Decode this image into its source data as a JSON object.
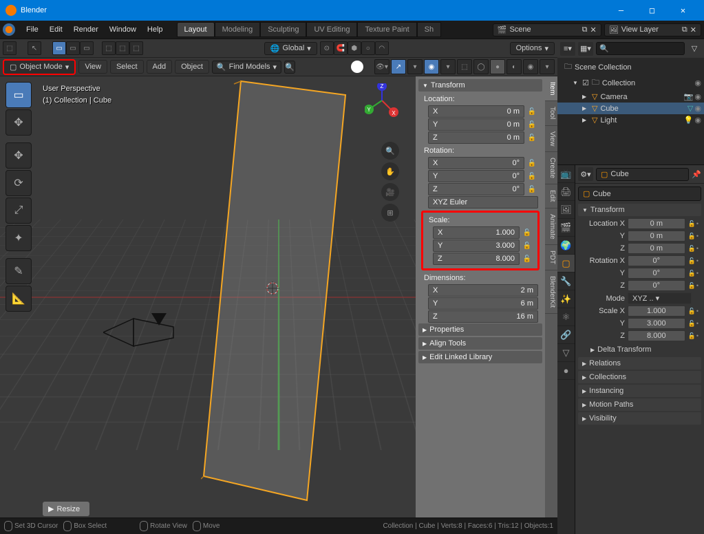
{
  "window": {
    "title": "Blender"
  },
  "window_controls": {
    "min": "—",
    "max": "□",
    "close": "✕"
  },
  "menu": {
    "file": "File",
    "edit": "Edit",
    "render": "Render",
    "window": "Window",
    "help": "Help"
  },
  "workspace_tabs": [
    "Layout",
    "Modeling",
    "Sculpting",
    "UV Editing",
    "Texture Paint",
    "Sh"
  ],
  "scene_field": {
    "label": "Scene",
    "icon": "🎬"
  },
  "viewlayer_field": {
    "label": "View Layer",
    "icon": "🖼"
  },
  "header": {
    "orientation": "Global",
    "options": "Options"
  },
  "toolbar2": {
    "mode": "Object Mode",
    "view": "View",
    "select": "Select",
    "add": "Add",
    "object": "Object",
    "find_models": "Find Models",
    "search_placeholder": ""
  },
  "viewport_info": {
    "line1": "User Perspective",
    "line2": "(1) Collection | Cube"
  },
  "n_panel": {
    "header": "Transform",
    "location_label": "Location:",
    "rotation_label": "Rotation:",
    "euler": "XYZ Euler",
    "scale_label": "Scale:",
    "dimensions_label": "Dimensions:",
    "loc": {
      "x": "0 m",
      "y": "0 m",
      "z": "0 m"
    },
    "rot": {
      "x": "0°",
      "y": "0°",
      "z": "0°"
    },
    "scale": {
      "x": "1.000",
      "y": "3.000",
      "z": "8.000"
    },
    "dim": {
      "x": "2 m",
      "y": "6 m",
      "z": "16 m"
    },
    "properties": "Properties",
    "align_tools": "Align Tools",
    "edit_linked": "Edit Linked Library",
    "tabs": [
      "Item",
      "Tool",
      "View",
      "Create",
      "Edit",
      "Animate",
      "PDT",
      "BlenderKit"
    ]
  },
  "resize_label": "Resize",
  "outliner": {
    "scene_collection": "Scene Collection",
    "collection": "Collection",
    "items": [
      {
        "name": "Camera",
        "icon": "📷",
        "color": "#4db6ac"
      },
      {
        "name": "Cube",
        "icon": "▽",
        "color": "#ffa726"
      },
      {
        "name": "Light",
        "icon": "💡",
        "color": "#cddc39"
      }
    ]
  },
  "properties": {
    "object_name": "Cube",
    "name_field": "Cube",
    "transform_hdr": "Transform",
    "loc_x_lbl": "Location X",
    "loc_y_lbl": "Y",
    "loc_z_lbl": "Z",
    "rot_x_lbl": "Rotation X",
    "rot_y_lbl": "Y",
    "rot_z_lbl": "Z",
    "mode_lbl": "Mode",
    "mode_val": "XYZ ..",
    "scale_x_lbl": "Scale X",
    "scale_y_lbl": "Y",
    "scale_z_lbl": "Z",
    "loc": {
      "x": "0 m",
      "y": "0 m",
      "z": "0 m"
    },
    "rot": {
      "x": "0°",
      "y": "0°",
      "z": "0°"
    },
    "scale": {
      "x": "1.000",
      "y": "3.000",
      "z": "8.000"
    },
    "delta": "Delta Transform",
    "sections": [
      "Relations",
      "Collections",
      "Instancing",
      "Motion Paths",
      "Visibility"
    ]
  },
  "status": {
    "hints": [
      {
        "label": "Set 3D Cursor"
      },
      {
        "label": "Box Select"
      },
      {
        "label": "Rotate View"
      },
      {
        "label": "Move"
      }
    ],
    "right": "Collection | Cube | Verts:8 | Faces:6 | Tris:12 | Objects:1"
  }
}
